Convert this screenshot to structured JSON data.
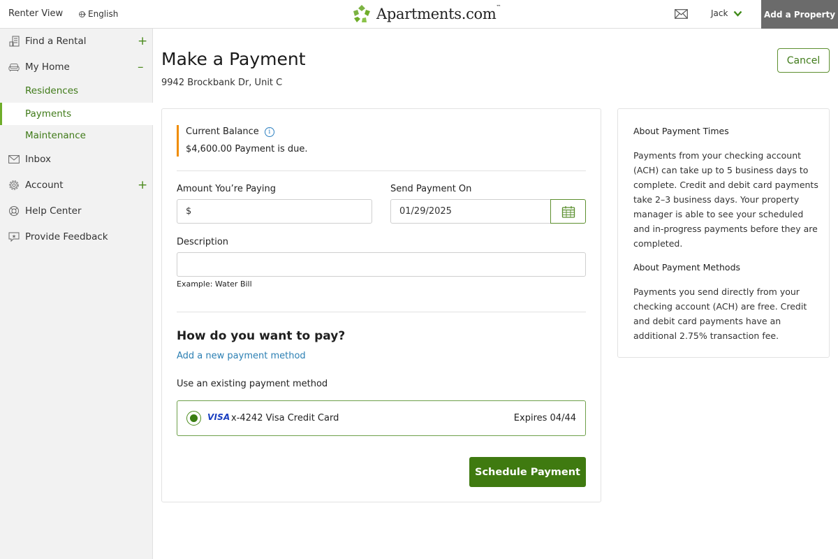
{
  "header": {
    "renter_view": "Renter View",
    "language": "English",
    "brand": "Apartments.com",
    "brand_tm": "™",
    "user_name": "Jack",
    "add_property": "Add a Property",
    "brand_color": "#6fad2a"
  },
  "sidebar": {
    "items": [
      {
        "label": "Find a Rental",
        "icon": "building-icon",
        "toggle": "+"
      },
      {
        "label": "My Home",
        "icon": "sofa-icon",
        "toggle": "–"
      },
      {
        "label": "Inbox",
        "icon": "envelope-icon"
      },
      {
        "label": "Account",
        "icon": "gear-icon",
        "toggle": "+"
      },
      {
        "label": "Help Center",
        "icon": "lifebuoy-icon"
      },
      {
        "label": "Provide Feedback",
        "icon": "feedback-icon"
      }
    ],
    "sub_items": [
      {
        "label": "Residences",
        "active": false
      },
      {
        "label": "Payments",
        "active": true
      },
      {
        "label": "Maintenance",
        "active": false
      }
    ]
  },
  "page": {
    "title": "Make a Payment",
    "address": "9942 Brockbank Dr, Unit C",
    "cancel_label": "Cancel"
  },
  "form": {
    "balance_title": "Current Balance",
    "balance_amount": "$4,600.00",
    "balance_status": "Payment is due.",
    "amount_label": "Amount You’re Paying",
    "amount_value": "$",
    "date_label": "Send Payment On",
    "date_value": "01/29/2025",
    "description_label": "Description",
    "description_value": "",
    "description_hint": "Example: Water Bill",
    "pay_title": "How do you want to pay?",
    "add_method_link": "Add a new payment method",
    "existing_label": "Use an existing payment method",
    "method": {
      "brand": "VISA",
      "name": "x-4242 Visa Credit Card",
      "expires": "Expires 04/44",
      "selected": true
    },
    "submit_label": "Schedule Payment"
  },
  "aside": {
    "times_title": "About Payment Times",
    "times_body": "Payments from your checking account (ACH) can take up to 5 business days to complete. Credit and debit card payments take 2–3 business days. Your property manager is able to see your scheduled and in-progress payments before they are completed.",
    "methods_title": "About Payment Methods",
    "methods_body": "Payments you send directly from your checking account (ACH) are free. Credit and debit card payments have an additional 2.75% transaction fee."
  }
}
